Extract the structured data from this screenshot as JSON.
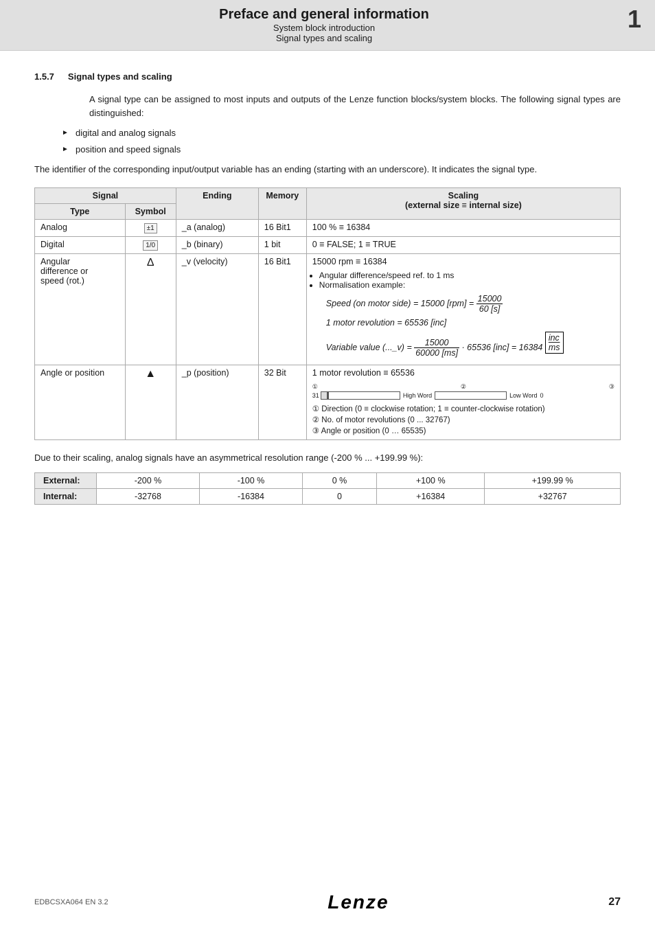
{
  "header": {
    "title": "Preface and general information",
    "subtitle1": "System block introduction",
    "subtitle2": "Signal types and scaling",
    "chapter_num": "1"
  },
  "section": {
    "number": "1.5.7",
    "title": "Signal types and scaling"
  },
  "intro_para1": "A signal type can be assigned to most inputs and outputs of the Lenze function blocks/system blocks. The following signal types are distinguished:",
  "bullets": [
    "digital and analog signals",
    "position and speed signals"
  ],
  "intro_para2": "The identifier of the corresponding input/output variable has an ending (starting with an underscore). It indicates the signal type.",
  "table": {
    "headers": [
      "Signal",
      "",
      "Ending",
      "Memory",
      "Scaling"
    ],
    "subheaders": [
      "Type",
      "Symbol",
      "",
      "",
      "(external size ≡ internal size)"
    ],
    "rows": [
      {
        "type": "Analog",
        "symbol": "±1",
        "ending": "_a (analog)",
        "memory": "16 Bit1",
        "scaling": "100 % ≡ 16384"
      },
      {
        "type": "Digital",
        "symbol": "1/0",
        "ending": "_b (binary)",
        "memory": "1 bit",
        "scaling": "0 ≡ FALSE; 1 ≡ TRUE"
      },
      {
        "type": "Angular difference or speed (rot.)",
        "symbol": "Δ",
        "ending": "_v (velocity)",
        "memory": "16 Bit1",
        "scaling_main": "15000 rpm ≡ 16384",
        "scaling_extra": true
      },
      {
        "type": "Angle or position",
        "symbol": "▲",
        "ending": "_p (position)",
        "memory": "32 Bit",
        "scaling": "1 motor revolution ≡ 65536"
      }
    ]
  },
  "angular_notes": {
    "bullet1": "Angular difference/speed ref. to 1 ms",
    "bullet2": "Normalisation example:",
    "formula1_label": "Speed (on motor side) = 15000 [rpm] =",
    "formula1_num": "15000",
    "formula1_den": "60 [s]",
    "formula2_label": "1 motor revolution = 65536 [inc]",
    "formula3_pre": "Variable value (..._v) =",
    "formula3_num": "15000",
    "formula3_den": "60000 [ms]",
    "formula3_mid": "· 65536 [inc] = 16384",
    "formula3_box": "inc/ms"
  },
  "position_notes": {
    "note1": "① Direction (0 ≡ clockwise rotation; 1 ≡ counter-clockwise rotation)",
    "note2": "② No. of motor revolutions (0 ... 32767)",
    "note3": "③ Angle or position (0 … 65535)"
  },
  "resolution_intro": "Due to their scaling, analog signals have an asymmetrical resolution range (-200 % ... +199.99 %):",
  "resolution_table": {
    "headers": [
      "",
      "-200 %",
      "-100 %",
      "0 %",
      "+100 %",
      "+199.99 %"
    ],
    "rows": [
      {
        "label": "External:",
        "values": [
          "-200 %",
          "-100 %",
          "0 %",
          "+100 %",
          "+199.99 %"
        ]
      },
      {
        "label": "Internal:",
        "values": [
          "-32768",
          "-16384",
          "0",
          "+16384",
          "+32767"
        ]
      }
    ]
  },
  "footer": {
    "doc_code": "EDBCSXA064  EN  3.2",
    "brand": "Lenze",
    "page": "27"
  }
}
